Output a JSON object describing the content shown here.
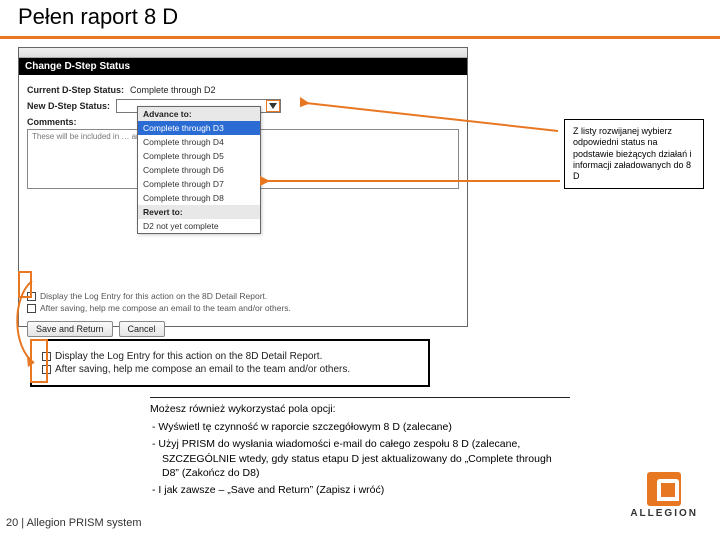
{
  "title": "Pełen raport 8 D",
  "app": {
    "header": "Change D-Step Status",
    "currentLabel": "Current D-Step Status:",
    "currentValue": "Complete through D2",
    "newLabel": "New D-Step Status:",
    "commentsLabel": "Comments:",
    "commentsHint": "These will be included in …  and cannot be edited once saved.",
    "dropdown": {
      "advanceHeader": "Advance to:",
      "items": [
        "Complete through D3",
        "Complete through D4",
        "Complete through D5",
        "Complete through D6",
        "Complete through D7",
        "Complete through D8"
      ],
      "revertHeader": "Revert to:",
      "revertItem": "D2 not yet complete"
    },
    "check1": "Display the Log Entry for this action on the 8D Detail Report.",
    "check2": "After saving, help me compose an email to the team and/or others.",
    "btnSave": "Save and Return",
    "btnCancel": "Cancel"
  },
  "calloutR": "Z listy rozwijanej wybierz odpowiedni status na podstawie bieżących działań i informacji załadowanych do 8 D",
  "blackBox": {
    "line1": "Display the Log Entry for this action on the 8D Detail Report.",
    "line2": "After saving, help me compose an email to the team and/or others."
  },
  "notes": {
    "intro": "Możesz również wykorzystać pola opcji:",
    "li1": "Wyświetl tę czynność w raporcie szczegółowym 8 D (zalecane)",
    "li2": "Użyj PRISM do wysłania wiadomości e-mail do całego zespołu 8 D (zalecane, SZCZEGÓLNIE wtedy, gdy status etapu D jest aktualizowany do „Complete through D8” (Zakończ do D8)",
    "li3": "I jak zawsze – „Save and Return” (Zapisz i wróć)"
  },
  "footer": "20 | Allegion PRISM system",
  "logoText": "ALLEGION"
}
